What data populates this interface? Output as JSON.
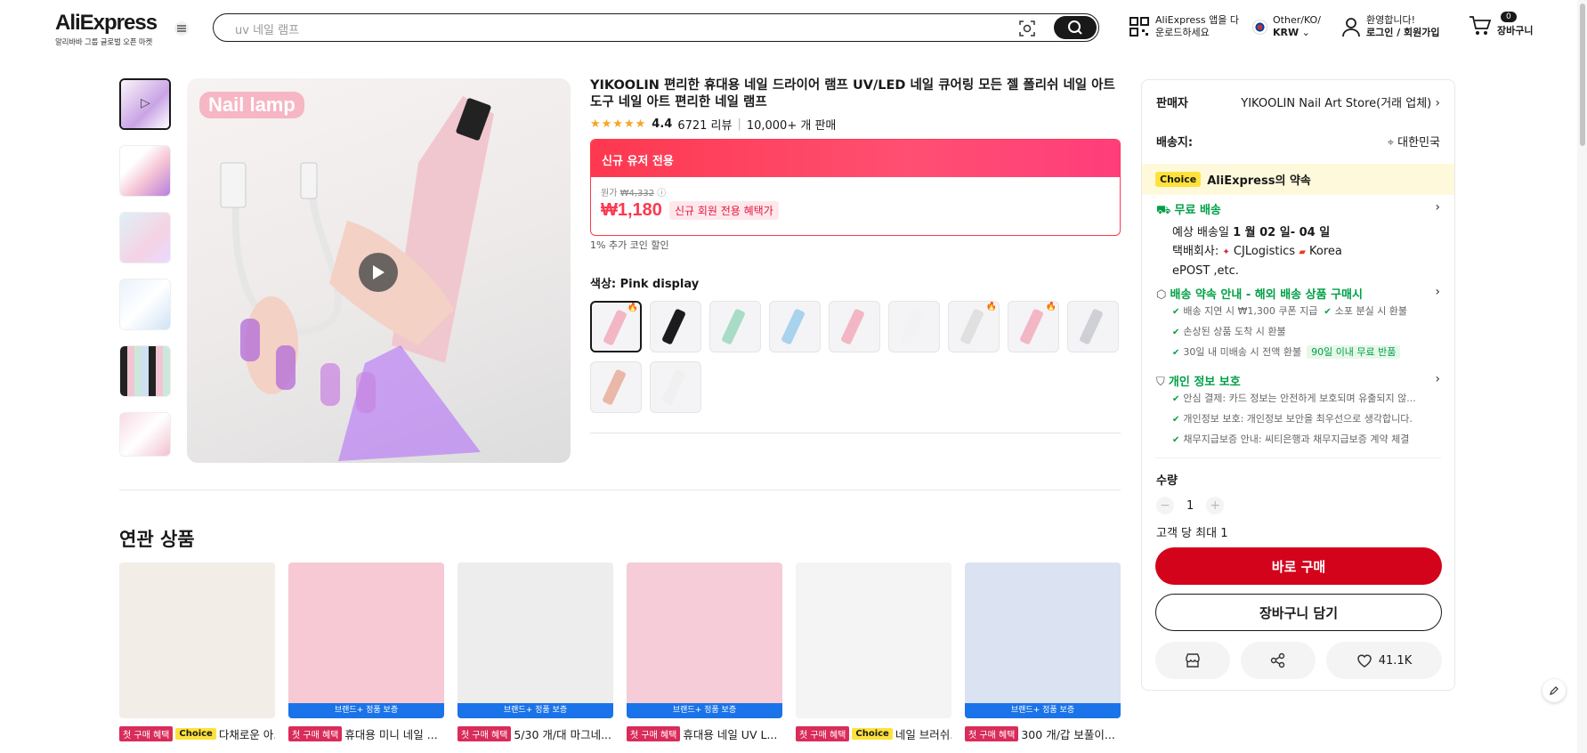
{
  "header": {
    "logo_text": "AliExpress",
    "logo_sub": "알리바바 그룹 글로벌 오픈 마켓",
    "search_placeholder": "uv 네일 램프",
    "app_line1": "AliExpress 앱을 다",
    "app_line2": "운로드하세요",
    "region_line1": "Other/KO/",
    "region_line2": "KRW",
    "account_line1": "환영합니다!",
    "account_line2": "로그인 / 회원가입",
    "cart_count": "0",
    "cart_label": "장바구니"
  },
  "product": {
    "image_tag": "Nail lamp",
    "title": "YIKOOLIN 편리한 휴대용 네일 드라이어 램프 UV/LED 네일 큐어링 모든 젤 폴리쉬 네일 아트 도구 네일 아트 편리한 네일 램프",
    "stars": "★★★★★",
    "rating": "4.4",
    "reviews": "6721 리뷰",
    "sold": "10,000+ 개 판매",
    "promo_header": "신규 유저 전용",
    "orig_label": "원가",
    "orig_price": "₩4,332",
    "price": "₩1,180",
    "new_badge": "신규 회원 전용 혜택가",
    "coin_note": "1% 추가 코인 할인",
    "color_label": "색상: Pink display",
    "swatches": [
      {
        "color": "#f3b6c5",
        "hot": "🔥"
      },
      {
        "color": "#1c1c1c",
        "hot": ""
      },
      {
        "color": "#a9dcc6",
        "hot": ""
      },
      {
        "color": "#a9d2ec",
        "hot": ""
      },
      {
        "color": "#f3b6c5",
        "hot": ""
      },
      {
        "color": "#f2f2f2",
        "hot": ""
      },
      {
        "color": "#e0e0e0",
        "hot": "🔥"
      },
      {
        "color": "#f3b6c5",
        "hot": "🔥"
      },
      {
        "color": "#cfd0d6",
        "hot": ""
      },
      {
        "color": "#e9b8a8",
        "hot": ""
      },
      {
        "color": "#f0f0f0",
        "hot": ""
      }
    ]
  },
  "related": {
    "title": "연관 상품",
    "first_tag": "첫 구매 혜택",
    "choice_tag": "Choice",
    "brand_bar": "브랜드+ 정품 보증",
    "items": [
      {
        "name": "다채로운 아...",
        "choice": true,
        "brand": false,
        "bg": "#f3ede8"
      },
      {
        "name": "휴대용 미니 네일 ...",
        "choice": false,
        "brand": true,
        "bg": "#f7c9d5"
      },
      {
        "name": "5/30 개/대 마그네...",
        "choice": false,
        "brand": true,
        "bg": "#ededed"
      },
      {
        "name": "휴대용 네일 UV L...",
        "choice": false,
        "brand": true,
        "bg": "#f5ccd8"
      },
      {
        "name": "네일 브러쉬...",
        "choice": true,
        "brand": false,
        "bg": "#f4f4f4"
      },
      {
        "name": "300 개/갑 보풀이...",
        "choice": false,
        "brand": true,
        "bg": "#dbe2f2"
      }
    ]
  },
  "panel": {
    "seller_label": "판매자",
    "seller_name": "YIKOOLIN Nail Art Store(거래 업체)",
    "ship_to_label": "배송지:",
    "ship_to": "대한민국",
    "choice_chip": "Choice",
    "choice_text": "AliExpress의 약속",
    "free_ship": "무료 배송",
    "eta_prefix": "예상 배송일",
    "eta": "1 월 02 일- 04 일",
    "carrier_prefix": "택배회사:",
    "carrier1": "CJLogistics",
    "carrier2": "Korea",
    "carrier3": "ePOST ,etc.",
    "promise_title": "배송 약속 안내 - 해외 배송 상품 구매시",
    "promise_items": [
      "배송 지연 시 ₩1,300 쿠폰 지급",
      "소포 분실 시 환불",
      "손상된 상품 도착 시 환불",
      "30일 내 미배송 시 전액 환불"
    ],
    "days90": "90일 이내 무료 반품",
    "privacy_title": "개인 정보 보호",
    "privacy_items": [
      "안심 결제: 카드 정보는 안전하게 보호되며 유출되지 않...",
      "개인정보 보호: 개인정보 보안을 최우선으로 생각합니다.",
      "채무지급보증 안내: 씨티은행과 채무지급보증 계약 체결"
    ],
    "qty_label": "수량",
    "qty": "1",
    "limit": "고객 당 최대 1",
    "buy_label": "바로 구매",
    "cart_label": "장바구니 담기",
    "wish_count": "41.1K"
  },
  "colors": {
    "accent": "#fd384f",
    "buy": "#d3031c",
    "green": "#00a046"
  }
}
